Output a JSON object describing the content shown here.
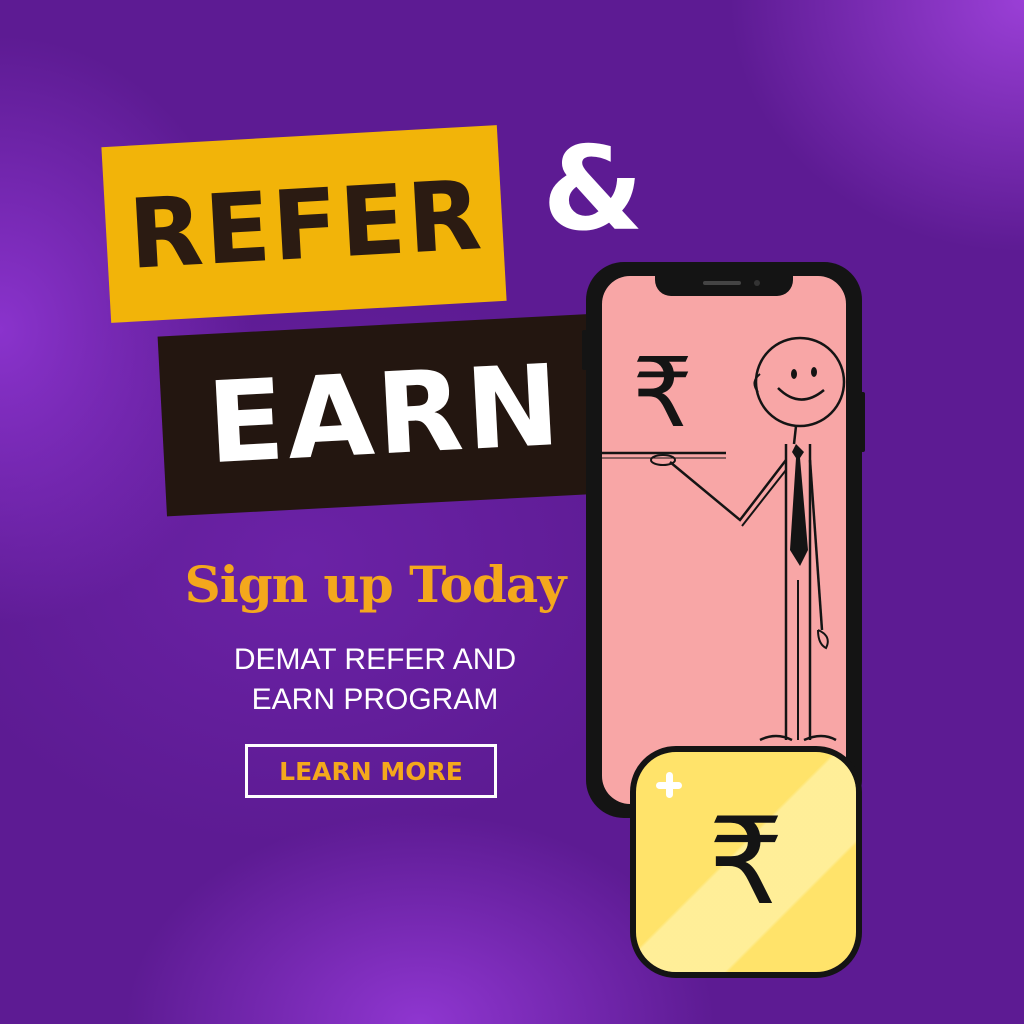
{
  "headline": {
    "refer": "REFER",
    "ampersand": "&",
    "earn": "EARN"
  },
  "signup_text": "Sign up Today",
  "subtitle": {
    "line1": "DEMAT REFER AND",
    "line2": "EARN PROGRAM"
  },
  "cta": {
    "label": "LEARN MORE"
  },
  "phone": {
    "screen_symbol": "₹"
  },
  "coin": {
    "symbol": "₹"
  },
  "colors": {
    "background": "#5d1b93",
    "refer_box": "#f2b409",
    "earn_box": "#231610",
    "accent_text": "#f4a81c",
    "phone_screen": "#f8a6a6",
    "coin": "#ffe36a"
  },
  "icons": [
    "rupee-icon",
    "stick-figure-illustration",
    "sparkle-icon",
    "rupee-coin-icon"
  ]
}
